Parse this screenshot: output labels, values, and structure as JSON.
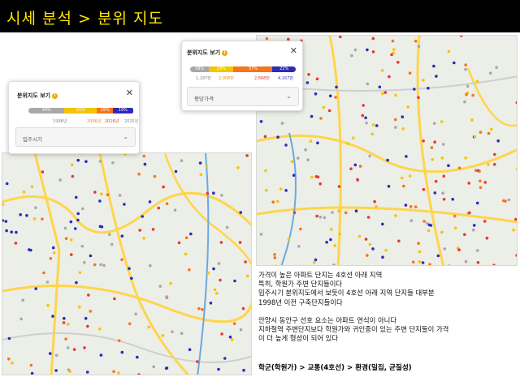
{
  "header": {
    "title": "시세 분석 > 분위 지도"
  },
  "colors": {
    "gray": "#a8a8a8",
    "yellow": "#f5c400",
    "orange": "#f4741f",
    "red": "#e53935",
    "blue": "#2f2ab8",
    "title": "#ffe600"
  },
  "card_left": {
    "title": "분위지도 보기",
    "close_icon": "close-icon",
    "segments": [
      {
        "label": "34%",
        "share": 34,
        "color": "#a8a8a8"
      },
      {
        "label": "31%",
        "share": 31,
        "color": "#f5c400"
      },
      {
        "label": "15%",
        "share": 15,
        "color": "#f4741f"
      },
      {
        "label": "19%",
        "share": 19,
        "color": "#2f2ab8"
      }
    ],
    "ticks": [
      "1998년",
      "2006년",
      "2016년",
      "2025년"
    ],
    "dropdown": {
      "label": "입주시기",
      "icon": "chevron-down-icon"
    }
  },
  "card_right": {
    "title": "분위지도 보기",
    "close_icon": "close-icon",
    "segments": [
      {
        "label": "18%",
        "share": 18,
        "color": "#a8a8a8"
      },
      {
        "label": "23%",
        "share": 23,
        "color": "#f5c400"
      },
      {
        "label": "37%",
        "share": 37,
        "color": "#f4741f"
      },
      {
        "label": "22%",
        "share": 22,
        "color": "#2f2ab8"
      }
    ],
    "ticks": [
      "1,187만",
      "2,008만",
      "2,868만",
      "4,167만"
    ],
    "dropdown": {
      "label": "평당가격",
      "icon": "chevron-down-icon"
    }
  },
  "notes": {
    "lines1": [
      "가격이 높은 아파트 단지는 4호선 아래 지역",
      "특히, 학원가 주변 단지들이다",
      "입주시기 분위지도에서 보듯이 4호선 아래 지역 단지들 대부분",
      "1998년 이전 구축단지들이다"
    ],
    "lines2": [
      "안양시 동안구 선호 요소는 아파트 연식이 아니다",
      "지하철역 주변단지보다 학원가와 귀인중이 있는 주변 단지들이 가격",
      "이 더 높게 형성이 되어 있다"
    ],
    "summary": "학군(학원가) > 교통(4호선) > 환경(밀집, 균질성)"
  }
}
